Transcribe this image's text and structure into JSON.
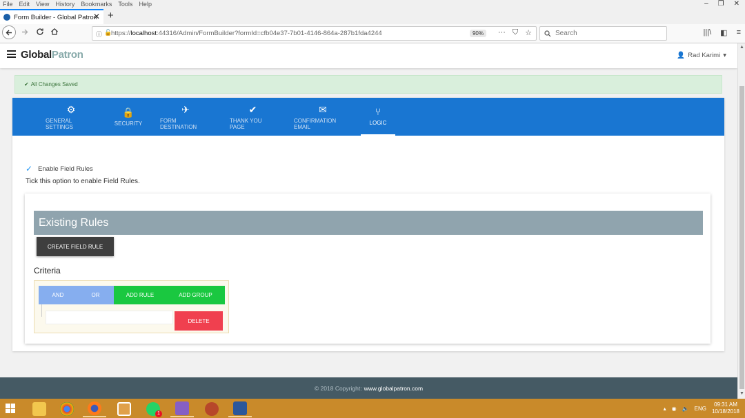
{
  "browser": {
    "menu": [
      "File",
      "Edit",
      "View",
      "History",
      "Bookmarks",
      "Tools",
      "Help"
    ],
    "window_controls": [
      "–",
      "❐",
      "✕"
    ],
    "tab_title": "Form Builder - Global Patron",
    "tab_close": "✕",
    "new_tab": "+",
    "url_prefix": "https://",
    "url_host": "localhost",
    "url_rest": ":44316/Admin/FormBuilder?formId=cfb04e37-7b01-4146-864a-287b1fda4244",
    "zoom": "90%",
    "search_placeholder": "Search"
  },
  "app": {
    "logo_bold": "Global",
    "logo_light": "Patron",
    "user_name": "Rad Karimi"
  },
  "alert": {
    "text": "All Changes Saved"
  },
  "tabs": [
    {
      "label": "GENERAL SETTINGS",
      "icon": "⚙"
    },
    {
      "label": "SECURITY",
      "icon": "🔒"
    },
    {
      "label": "FORM DESTINATION",
      "icon": "✈"
    },
    {
      "label": "THANK YOU PAGE",
      "icon": "✔"
    },
    {
      "label": "CONFIRMATION EMAIL",
      "icon": "✉"
    },
    {
      "label": "LOGIC",
      "icon": "⑂"
    }
  ],
  "logic": {
    "enable_label": "Enable Field Rules",
    "hint": "Tick this option to enable Field Rules.",
    "existing_rules_title": "Existing Rules",
    "create_button": "CREATE FIELD RULE",
    "criteria_label": "Criteria",
    "and_button": "AND",
    "or_button": "OR",
    "add_rule_button": "ADD RULE",
    "add_group_button": "ADD GROUP",
    "delete_button": "DELETE"
  },
  "footer": {
    "copyright": "© 2018 Copyright:",
    "link": "www.globalpatron.com"
  },
  "taskbar": {
    "lang": "ENG",
    "time": "09:31 AM",
    "date": "10/18/2018",
    "badge": "1"
  },
  "colors": {
    "primary": "#1976d2",
    "success_bg": "#d9efdc",
    "rules_header": "#90a4ae",
    "footer_bg": "#455a64",
    "add_green": "#1ac840",
    "delete_red": "#f0404f"
  }
}
